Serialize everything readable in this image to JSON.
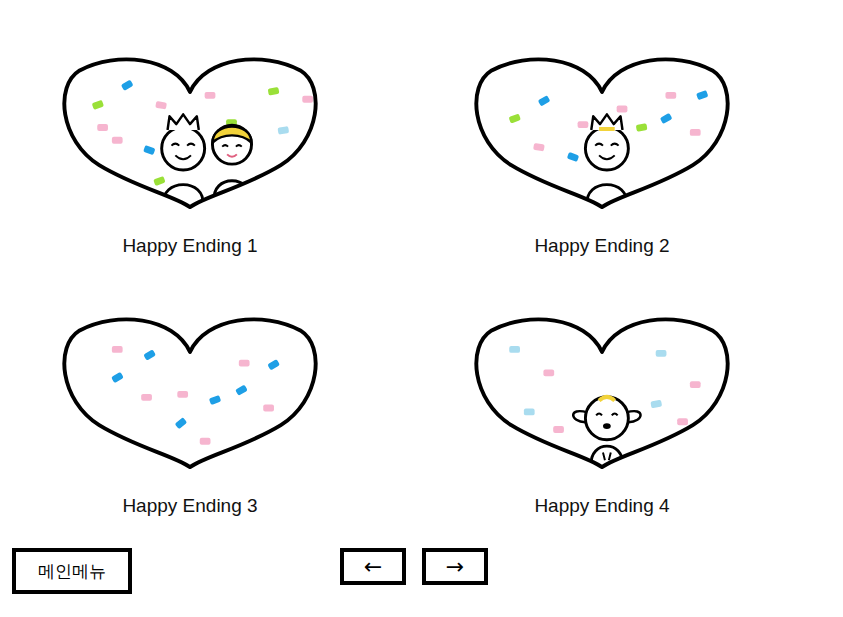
{
  "endings": [
    {
      "label": "Happy Ending 1",
      "kind": "couple"
    },
    {
      "label": "Happy Ending 2",
      "kind": "king"
    },
    {
      "label": "Happy Ending 3",
      "kind": "empty"
    },
    {
      "label": "Happy Ending 4",
      "kind": "sheep"
    }
  ],
  "buttons": {
    "menu": "메인메뉴",
    "prev": "←",
    "next": "→"
  }
}
